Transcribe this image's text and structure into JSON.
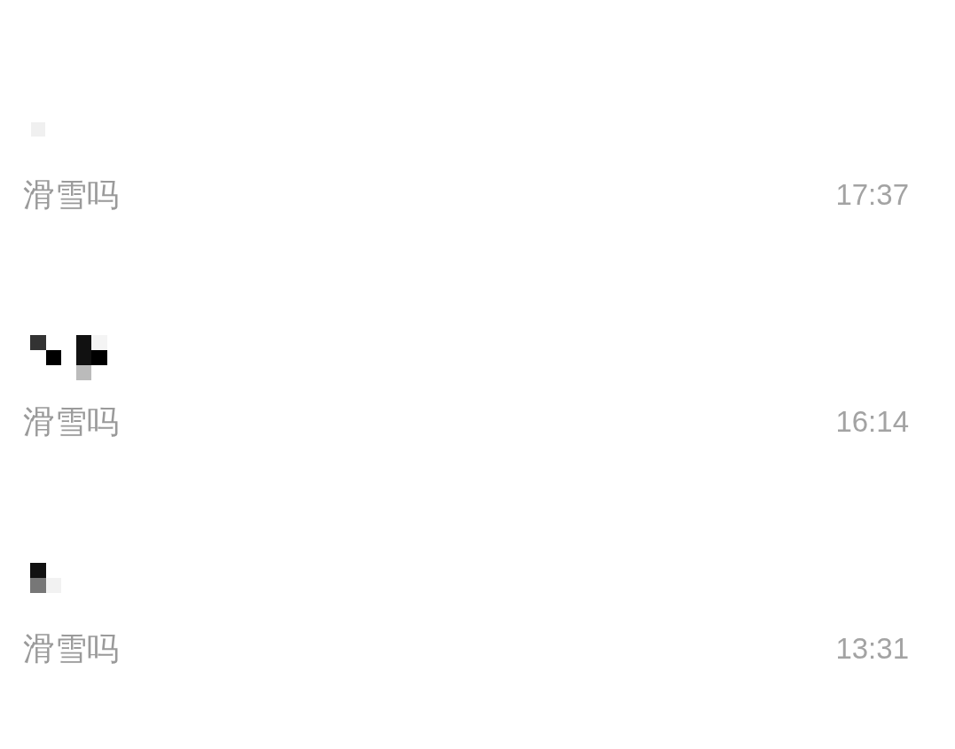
{
  "chats": [
    {
      "message": "滑雪吗",
      "time": "17:37"
    },
    {
      "message": "滑雪吗",
      "time": "16:14"
    },
    {
      "message": "滑雪吗",
      "time": "13:31"
    }
  ]
}
